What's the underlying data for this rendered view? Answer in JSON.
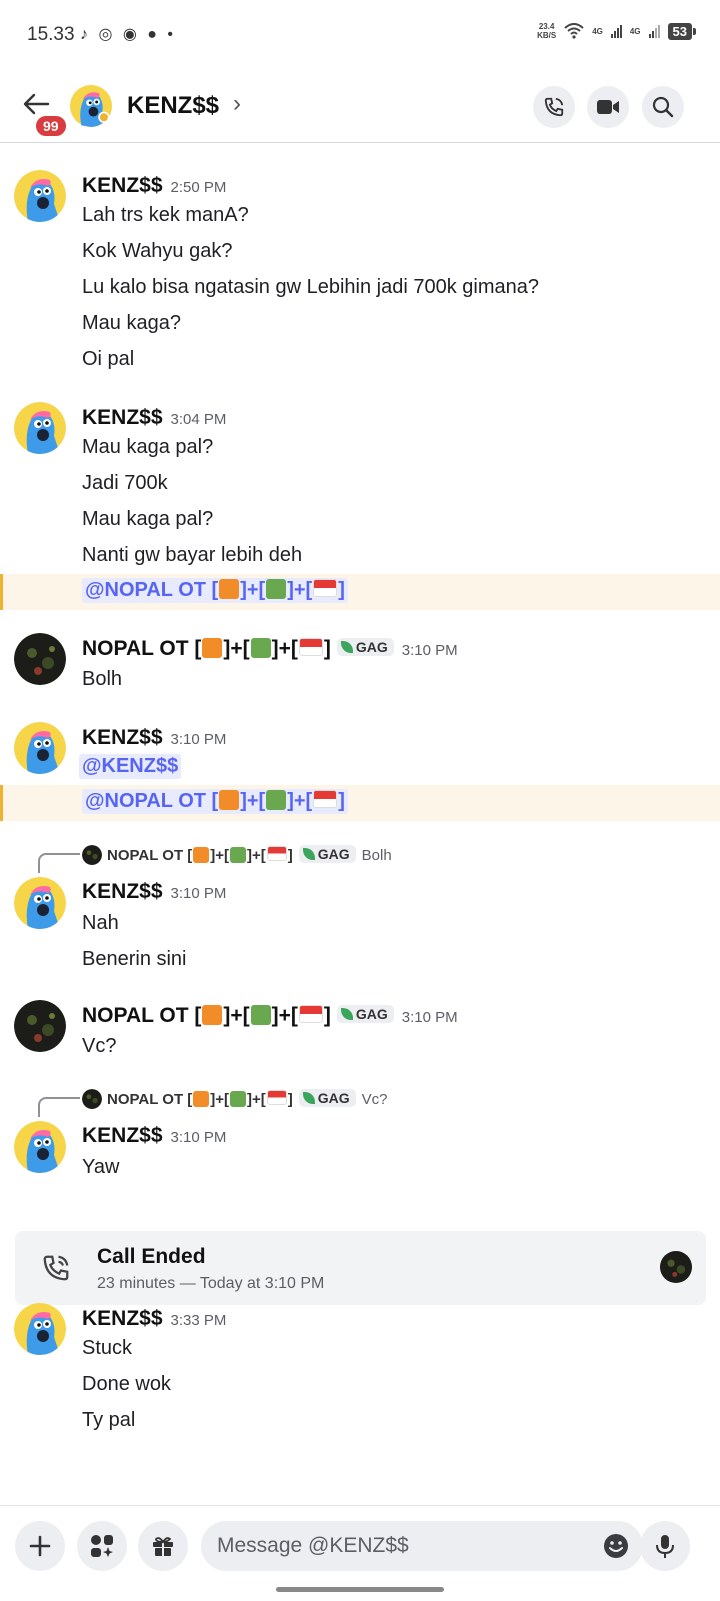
{
  "status_bar": {
    "time": "15.33",
    "notif_icons": "♪ ◎ ◉ ● •",
    "net_speed_top": "23.4",
    "net_speed_unit": "KB/S",
    "net1": "4G",
    "net2": "4G",
    "battery": "53"
  },
  "header": {
    "title": "KENZ$$",
    "unread_badge": "99"
  },
  "messages": [
    {
      "author": "KENZ$$",
      "time": "2:50 PM",
      "lines": [
        "Lah trs kek manA?",
        "Kok Wahyu gak?",
        "Lu kalo bisa ngatasin gw Lebihin jadi 700k gimana?",
        "Mau kaga?",
        "Oi pal"
      ]
    },
    {
      "author": "KENZ$$",
      "time": "3:04 PM",
      "lines": [
        "Mau kaga pal?",
        "Jadi 700k",
        "Mau kaga pal?",
        "Nanti gw bayar lebih deh"
      ],
      "mention": "@NOPAL OT ["
    },
    {
      "author": "NOPAL OT [",
      "tag": "GAG",
      "time": "3:10 PM",
      "lines": [
        "Bolh"
      ]
    },
    {
      "author": "KENZ$$",
      "time": "3:10 PM",
      "mention_self": "@KENZ$$",
      "mention": "@NOPAL OT ["
    },
    {
      "reply_author": "NOPAL OT [",
      "reply_tag": "GAG",
      "reply_text": "Bolh",
      "author": "KENZ$$",
      "time": "3:10 PM",
      "lines": [
        "Nah",
        "Benerin sini"
      ]
    },
    {
      "author": "NOPAL OT [",
      "tag": "GAG",
      "time": "3:10 PM",
      "lines": [
        "Vc?"
      ]
    },
    {
      "reply_author": "NOPAL OT [",
      "reply_tag": "GAG",
      "reply_text": "Vc?",
      "author": "KENZ$$",
      "time": "3:10 PM",
      "lines": [
        "Yaw"
      ]
    },
    {
      "author": "KENZ$$",
      "time": "3:33 PM",
      "lines": [
        "Stuck",
        "Done wok",
        "Ty pal"
      ]
    }
  ],
  "name_suffix": {
    "a": "]+[",
    "b": "]+[",
    "c": "]"
  },
  "call": {
    "title": "Call Ended",
    "subtitle": "23 minutes — Today at 3:10 PM"
  },
  "composer": {
    "placeholder": "Message @KENZ$$"
  },
  "colors": {
    "mention": "#5865f2",
    "mention_bg": "#fdf6e8",
    "mention_bar": "#f0b232",
    "badge": "#d83c3e"
  }
}
